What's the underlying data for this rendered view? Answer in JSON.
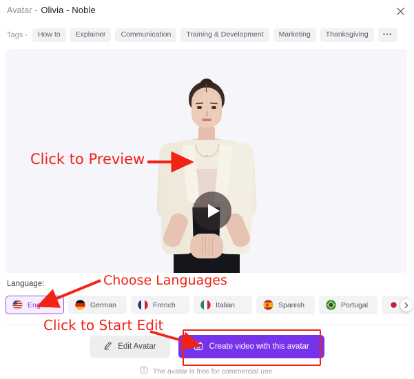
{
  "header": {
    "title_prefix": "Avatar -",
    "avatar_name": "Olivia - Noble",
    "close_icon": "close-icon"
  },
  "tags": {
    "label": "Tags -",
    "items": [
      "How to",
      "Explainer",
      "Communication",
      "Training & Development",
      "Marketing",
      "Thanksgiving"
    ],
    "more": "•••"
  },
  "preview": {
    "play_icon": "play-icon",
    "alt": "Avatar video preview of Olivia - Noble"
  },
  "language": {
    "label": "Language:",
    "options": [
      {
        "name": "English",
        "flag": "flag-us",
        "selected": true
      },
      {
        "name": "German",
        "flag": "flag-de",
        "selected": false
      },
      {
        "name": "French",
        "flag": "flag-fr",
        "selected": false
      },
      {
        "name": "Italian",
        "flag": "flag-it",
        "selected": false
      },
      {
        "name": "Spanish",
        "flag": "flag-es",
        "selected": false
      },
      {
        "name": "Portugal",
        "flag": "flag-br",
        "selected": false
      },
      {
        "name": "",
        "flag": "flag-jp",
        "selected": false
      }
    ],
    "next_icon": "chevron-right-icon"
  },
  "actions": {
    "edit_label": "Edit Avatar",
    "edit_icon": "pencil-icon",
    "create_label": "Create video with this avatar",
    "create_icon": "video-camera-icon",
    "create_color": "#7733eb"
  },
  "footer": {
    "info_icon": "info-icon",
    "note": "The avatar is free for commercial use."
  },
  "annotations": {
    "color": "#ee2117",
    "preview_text": "Click to Preview",
    "language_text": "Choose Languages",
    "edit_text": "Click to Start Edit"
  }
}
